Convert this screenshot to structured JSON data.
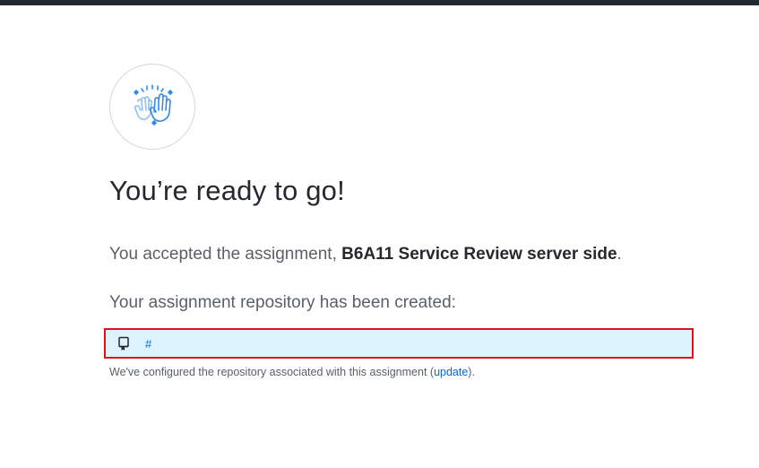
{
  "headline": "You’re ready to go!",
  "accepted": {
    "prefix": "You accepted the assignment, ",
    "assignment_name": "B6A11 Service Review server side",
    "suffix": "."
  },
  "repo_created_text": "Your assignment repository has been created:",
  "repo": {
    "icon": "repo-icon",
    "link_text": "#"
  },
  "configured": {
    "prefix": "We've configured the repository associated with this assignment (",
    "link_text": "update",
    "suffix": ")."
  },
  "colors": {
    "accent": "#0366d6",
    "highlight_border": "#e3101b",
    "repo_bg": "#ddf4ff",
    "icon_blue": "#2f8be6"
  },
  "hero_icon": "high-five-icon"
}
